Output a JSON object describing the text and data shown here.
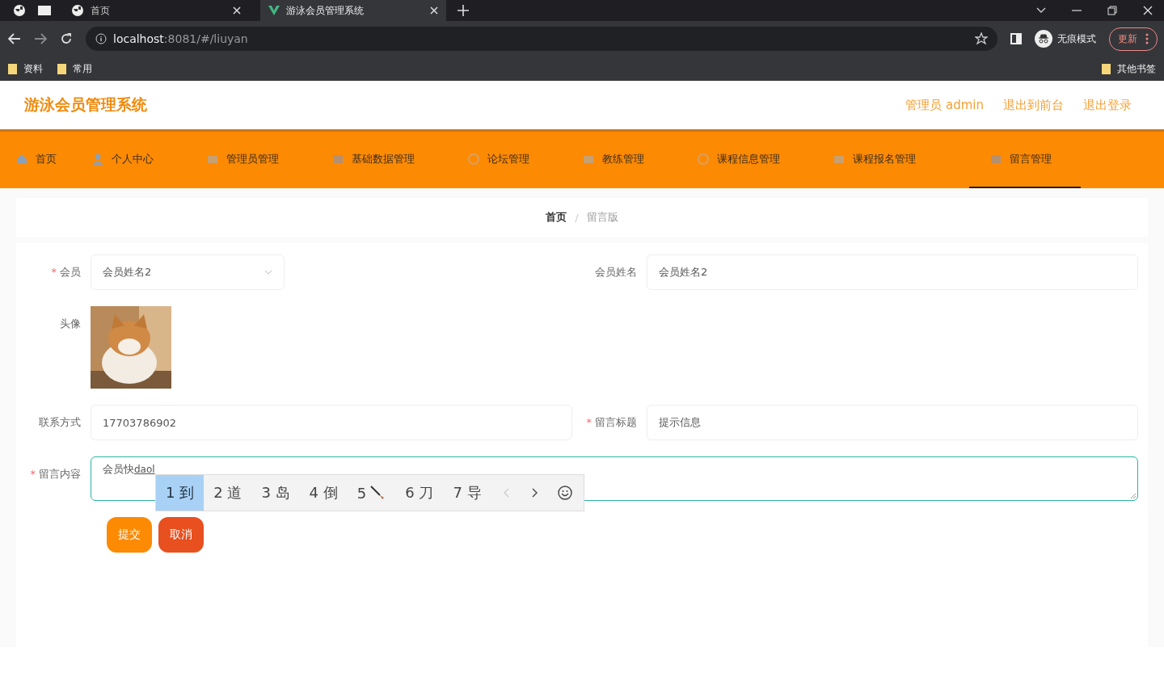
{
  "browser": {
    "tabs": [
      {
        "title": "首页",
        "selected": false
      },
      {
        "title": "游泳会员管理系统",
        "selected": true
      }
    ],
    "url": {
      "host": "localhost",
      "rest": ":8081/#/liuyan"
    },
    "profile_label": "无痕模式",
    "update_button": "更新",
    "bookmarks": [
      "资料",
      "常用"
    ],
    "other_bookmarks": "其他书签"
  },
  "header": {
    "title": "游泳会员管理系统",
    "links": [
      "管理员 admin",
      "退出到前台",
      "退出登录"
    ]
  },
  "nav": [
    {
      "label": "首页",
      "selected": false
    },
    {
      "label": "个人中心",
      "selected": false
    },
    {
      "label": "管理员管理",
      "selected": false
    },
    {
      "label": "基础数据管理",
      "selected": false
    },
    {
      "label": "论坛管理",
      "selected": false
    },
    {
      "label": "教练管理",
      "selected": false
    },
    {
      "label": "课程信息管理",
      "selected": false
    },
    {
      "label": "课程报名管理",
      "selected": false
    },
    {
      "label": "留言管理",
      "selected": true
    }
  ],
  "breadcrumb": [
    "首页",
    "留言版"
  ],
  "breadcrumb_separator": "/",
  "form": {
    "required_mark": "*",
    "rows": [
      [
        {
          "kind": "select",
          "label": "会员",
          "required": true,
          "value": "会员姓名2"
        },
        {
          "kind": "input",
          "label": "会员姓名",
          "required": false,
          "value": "会员姓名2"
        }
      ],
      [
        {
          "label": "头像",
          "required": false
        }
      ],
      [
        {
          "kind": "input",
          "label": "联系方式",
          "required": false,
          "value": "17703786902"
        },
        {
          "kind": "input",
          "label": "留言标题",
          "required": true,
          "value": "提示信息"
        }
      ],
      [
        {
          "kind": "textarea",
          "label": "留言内容",
          "required": true,
          "value": "会员快",
          "composition": "daol"
        }
      ]
    ],
    "buttons": [
      {
        "label": "提交",
        "kind": "primary"
      },
      {
        "label": "取消",
        "kind": "danger"
      }
    ]
  },
  "ime": {
    "candidates": [
      {
        "number": "1",
        "text": "到",
        "selected": true
      },
      {
        "number": "2",
        "text": "道",
        "selected": false
      },
      {
        "number": "3",
        "text": "岛",
        "selected": false
      },
      {
        "number": "4",
        "text": "倒",
        "selected": false
      },
      {
        "number": "5",
        "kind": "emoji",
        "selected": false
      },
      {
        "number": "6",
        "text": "刀",
        "selected": false
      },
      {
        "number": "7",
        "text": "导",
        "selected": false
      }
    ],
    "paging": [
      {
        "disabled": true
      },
      {
        "disabled": false
      }
    ]
  }
}
